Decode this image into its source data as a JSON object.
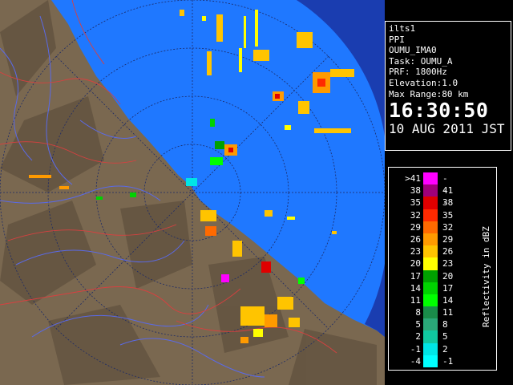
{
  "info": {
    "site": "ilts1",
    "mode": "PPI",
    "scan": "OUMU_IMA0",
    "task": "Task: OUMU_A",
    "prf": "PRF: 1800Hz",
    "elevation": "Elevation:1.0",
    "max_range": "Max Range:80 km",
    "time": "16:30:50",
    "date": "10 AUG 2011 JST"
  },
  "legend": {
    "title": "Reflectivity in dBZ",
    "rows": [
      {
        "lo": ">41",
        "hi": "---",
        "color": "#ff00ff"
      },
      {
        "lo": "38",
        "hi": "41",
        "color": "#a0007a"
      },
      {
        "lo": "35",
        "hi": "38",
        "color": "#e00000"
      },
      {
        "lo": "32",
        "hi": "35",
        "color": "#ff2a00"
      },
      {
        "lo": "29",
        "hi": "32",
        "color": "#ff6a00"
      },
      {
        "lo": "26",
        "hi": "29",
        "color": "#ff9a00"
      },
      {
        "lo": "23",
        "hi": "26",
        "color": "#ffc400"
      },
      {
        "lo": "20",
        "hi": "23",
        "color": "#ffff00"
      },
      {
        "lo": "17",
        "hi": "20",
        "color": "#00a000"
      },
      {
        "lo": "14",
        "hi": "17",
        "color": "#00d200"
      },
      {
        "lo": "11",
        "hi": "14",
        "color": "#00ff00"
      },
      {
        "lo": "8",
        "hi": "11",
        "color": "#1a8c4a"
      },
      {
        "lo": "5",
        "hi": "8",
        "color": "#2aa878"
      },
      {
        "lo": "2",
        "hi": "5",
        "color": "#10c8a0"
      },
      {
        "lo": "-1",
        "hi": "2",
        "color": "#00e6e6"
      },
      {
        "lo": "-4",
        "hi": "-1",
        "color": "#00ffff"
      }
    ]
  },
  "map": {
    "sea_color": "#1f78ff",
    "land_color": "#7a6850",
    "outer_color": "#1a3db0"
  }
}
